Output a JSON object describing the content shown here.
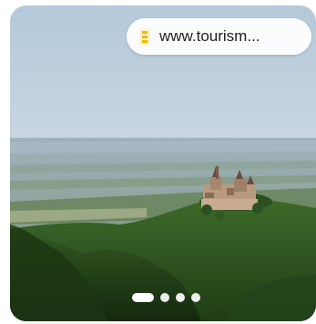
{
  "image_card": {
    "source_label": "www.tourism...",
    "source_icon": "site-favicon-icon",
    "image_subject": "castle-on-hill-landscape",
    "carousel": {
      "total": 4,
      "active_index": 0
    }
  }
}
